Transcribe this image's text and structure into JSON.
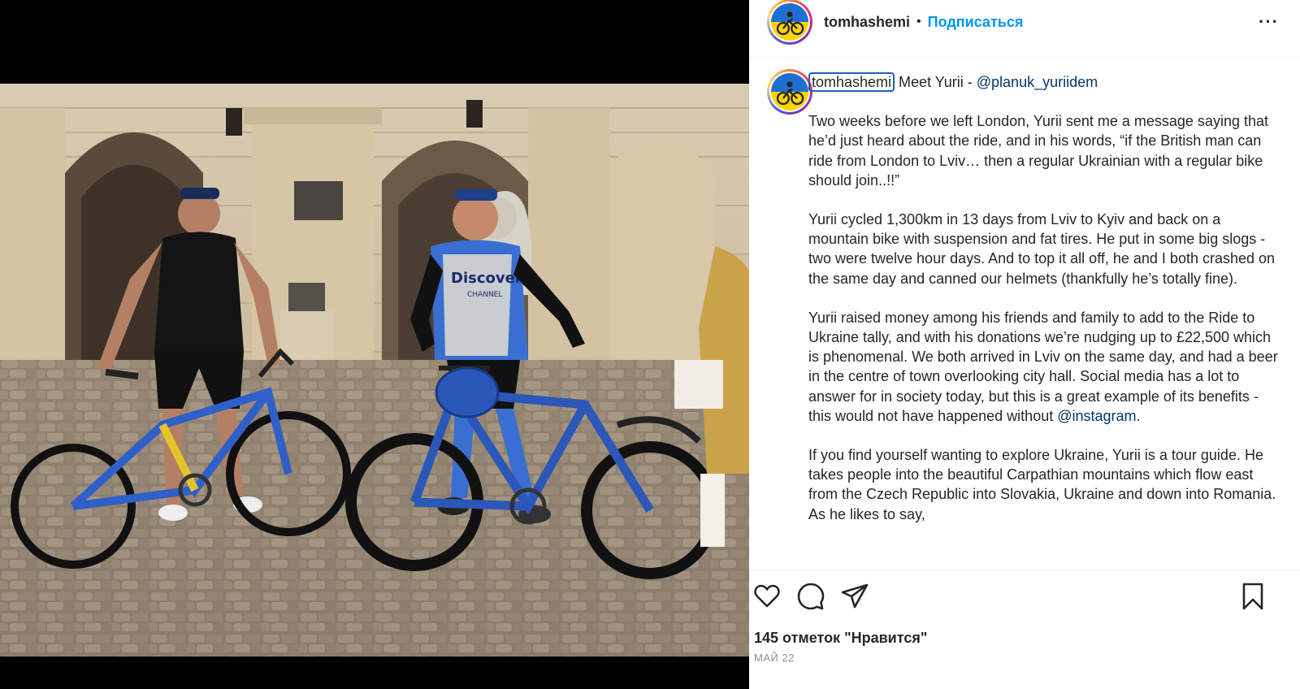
{
  "header": {
    "username": "tomhashemi",
    "separator": "•",
    "follow_label": "Подписаться",
    "more_label": "···"
  },
  "caption": {
    "username": "tomhashemi",
    "first_line_text": " Meet Yurii - ",
    "first_line_mention": "@planuk_yuriidem",
    "paragraph_1": "Two weeks before we left London, Yurii sent me a message saying that he’d just heard about the ride, and in his words, “if the British man can ride from London to Lviv… then a regular Ukrainian with a regular bike should join..!!”",
    "paragraph_2": "Yurii cycled 1,300km in 13 days from Lviv to Kyiv and back on a mountain bike with suspension and fat tires. He put in some big slogs - two were twelve hour days. And to top it all off, he and I both crashed on the same day and canned our helmets (thankfully he’s totally fine).",
    "paragraph_3_before": "Yurii raised money among his friends and family to add to the Ride to Ukraine tally, and with his donations we’re nudging up to £22,500 which is phenomenal. We both arrived in Lviv on the same day, and had a beer in the centre of town overlooking city hall. Social media has a lot to answer for in society today, but this is a great example of its benefits - this would not have happened without ",
    "paragraph_3_mention": "@instagram",
    "paragraph_3_after": ".",
    "paragraph_4": "If you find yourself wanting to explore Ukraine, Yurii is a tour guide. He takes people into the beautiful Carpathian mountains which flow east from the Czech Republic into Slovakia, Ukraine and down into Romania. As he likes to say,"
  },
  "stats": {
    "likes": "145 отметок \"Нравится\"",
    "date": "МАЙ 22"
  },
  "icons": {
    "like": "heart-icon",
    "comment": "comment-icon",
    "share": "paper-plane-icon",
    "save": "bookmark-icon",
    "more": "ellipsis-icon"
  },
  "colors": {
    "link": "#00376b",
    "follow": "#0095f6",
    "avatar_top": "#1f6fd1",
    "avatar_bottom": "#ffd500"
  },
  "photo": {
    "jersey_text": "Discovery",
    "jersey_subtext": "CHANNEL"
  }
}
